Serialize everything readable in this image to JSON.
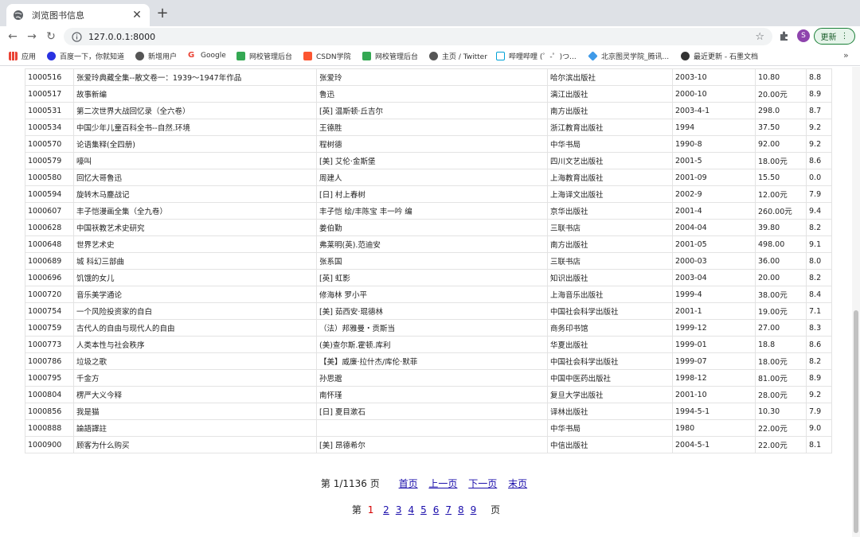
{
  "browser": {
    "tab_title": "浏览图书信息",
    "url": "127.0.0.1:8000",
    "avatar_letter": "S",
    "update_label": "更新",
    "bookmarks": [
      {
        "label": "应用",
        "color": "#4285f4"
      },
      {
        "label": "百度一下，你就知道",
        "color": "#2932e1"
      },
      {
        "label": "新增用户",
        "color": "#555555"
      },
      {
        "label": "Google",
        "color": "#ea4335"
      },
      {
        "label": "网校管理后台",
        "color": "#34a853"
      },
      {
        "label": "CSDN学院",
        "color": "#fc5531"
      },
      {
        "label": "网校管理后台",
        "color": "#34a853"
      },
      {
        "label": "主页 / Twitter",
        "color": "#555555"
      },
      {
        "label": "哔哩哔哩 (゜-゜)つ...",
        "color": "#00a1d6"
      },
      {
        "label": "北京图灵学院_腾讯...",
        "color": "#3f9ae8"
      },
      {
        "label": "最近更新 - 石墨文档",
        "color": "#333333"
      }
    ]
  },
  "books": [
    [
      "1000516",
      "张爱玲典藏全集--散文卷一：1939～1947年作品",
      "张爱玲",
      "哈尔滨出版社",
      "2003-10",
      "10.80",
      "8.8"
    ],
    [
      "1000517",
      "故事新编",
      "鲁迅",
      "漓江出版社",
      "2000-10",
      "20.00元",
      "8.9"
    ],
    [
      "1000531",
      "第二次世界大战回忆录（全六卷）",
      "[英] 温斯顿·丘吉尔",
      "南方出版社",
      "2003-4-1",
      "298.0",
      "8.7"
    ],
    [
      "1000534",
      "中国少年儿童百科全书--自然.环境",
      "王德胜",
      "浙江教育出版社",
      "1994",
      "37.50",
      "9.2"
    ],
    [
      "1000570",
      "论语集释(全四册)",
      "程树德",
      "中华书局",
      "1990-8",
      "92.00",
      "9.2"
    ],
    [
      "1000579",
      "嚎叫",
      "[美] 艾伦·金斯堡",
      "四川文艺出版社",
      "2001-5",
      "18.00元",
      "8.6"
    ],
    [
      "1000580",
      "回忆大哥鲁迅",
      "周建人",
      "上海教育出版社",
      "2001-09",
      "15.50",
      "0.0"
    ],
    [
      "1000594",
      "旋转木马鏖战记",
      "[日] 村上春树",
      "上海译文出版社",
      "2002-9",
      "12.00元",
      "7.9"
    ],
    [
      "1000607",
      "丰子恺漫画全集（全九卷）",
      "丰子恺 绘/丰陈宝 丰一吟 编",
      "京华出版社",
      "2001-4",
      "260.00元",
      "9.4"
    ],
    [
      "1000628",
      "中国祆教艺术史研究",
      "姜伯勤",
      "三联书店",
      "2004-04",
      "39.80",
      "8.2"
    ],
    [
      "1000648",
      "世界艺术史",
      "弗莱明(英).范迪安",
      "南方出版社",
      "2001-05",
      "498.00",
      "9.1"
    ],
    [
      "1000689",
      "城 科幻三部曲",
      "张系国",
      "三联书店",
      "2000-03",
      "36.00",
      "8.0"
    ],
    [
      "1000696",
      "饥饿的女儿",
      "[英] 虹影",
      "知识出版社",
      "2003-04",
      "20.00",
      "8.2"
    ],
    [
      "1000720",
      "音乐美学通论",
      "修海林 罗小平",
      "上海音乐出版社",
      "1999-4",
      "38.00元",
      "8.4"
    ],
    [
      "1000754",
      "一个风险投资家的自白",
      "[美] 茹西安·琨德林",
      "中国社会科学出版社",
      "2001-1",
      "19.00元",
      "7.1"
    ],
    [
      "1000759",
      "古代人的自由与现代人的自由",
      "（法）邦雅曼・贡斯当",
      "商务印书馆",
      "1999-12",
      "27.00",
      "8.3"
    ],
    [
      "1000773",
      "人类本性与社会秩序",
      "(美)查尔斯.霍顿.库利",
      "华夏出版社",
      "1999-01",
      "18.8",
      "8.6"
    ],
    [
      "1000786",
      "垃圾之歌",
      "【美】威廉·拉什杰/库伦·默菲",
      "中国社会科学出版社",
      "1999-07",
      "18.00元",
      "8.2"
    ],
    [
      "1000795",
      "千金方",
      "孙思邈",
      "中国中医药出版社",
      "1998-12",
      "81.00元",
      "8.9"
    ],
    [
      "1000804",
      "楞严大义今释",
      "南怀瑾",
      "复旦大学出版社",
      "2001-10",
      "28.00元",
      "9.2"
    ],
    [
      "1000856",
      "我是猫",
      "[日] 夏目漱石",
      "译林出版社",
      "1994-5-1",
      "10.30",
      "7.9"
    ],
    [
      "1000888",
      "論語譯註",
      "",
      "中华书局",
      "1980",
      "22.00元",
      "9.0"
    ],
    [
      "1000900",
      "顾客为什么购买",
      "[美] 昂德希尔",
      "中信出版社",
      "2004-5-1",
      "22.00元",
      "8.1"
    ]
  ],
  "pagination": {
    "status": "第 1/1136 页",
    "first": "首页",
    "prev": "上一页",
    "next": "下一页",
    "last": "末页",
    "prefix": "第",
    "current": "1",
    "pages": [
      "2",
      "3",
      "4",
      "5",
      "6",
      "7",
      "8",
      "9"
    ],
    "suffix": "页"
  }
}
